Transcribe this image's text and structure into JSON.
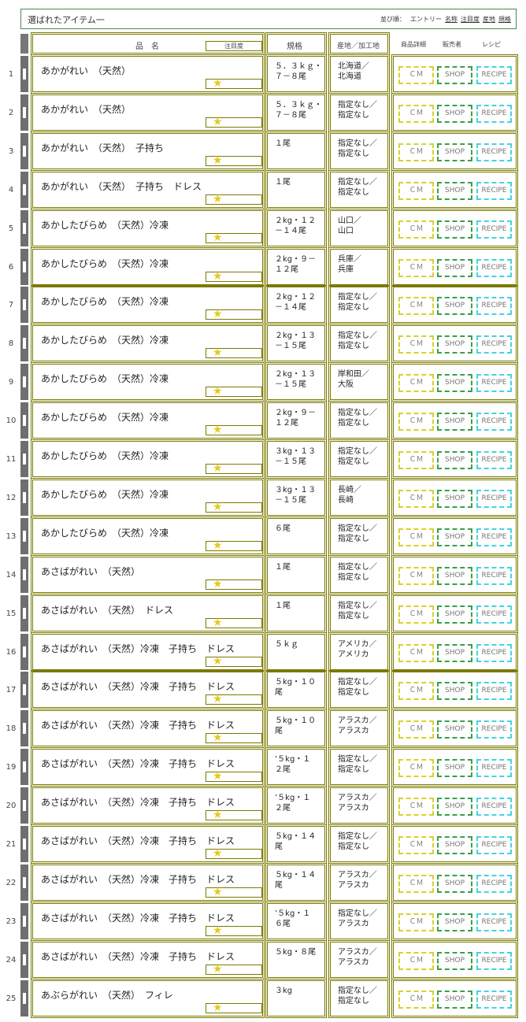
{
  "header": {
    "title": "選ばれたアイテム一",
    "sort_label": "並び順：",
    "sort_options": [
      "エントリー",
      "名称",
      "注目度",
      "産地",
      "規格"
    ]
  },
  "columns": {
    "name": "品　名",
    "attention": "注目度",
    "spec": "規格",
    "origin": "産地／加工地",
    "detail": "商品詳細",
    "seller": "販売者",
    "recipe": "レシピ"
  },
  "buttons": {
    "cm": "ＣＭ",
    "shop": "SHOP",
    "recipe": "RECIPE"
  },
  "star": "★",
  "rows": [
    {
      "no": "1",
      "name": "あかがれい　（天然）",
      "spec": "５．３ｋｇ・\n７－８尾",
      "origin": "北海道／\n北海道"
    },
    {
      "no": "2",
      "name": "あかがれい　（天然）",
      "spec": "５．３ｋｇ・\n７－８尾",
      "origin": "指定なし／\n指定なし"
    },
    {
      "no": "3",
      "name": "あかがれい　（天然）　子持ち",
      "spec": "１尾",
      "origin": "指定なし／\n指定なし"
    },
    {
      "no": "4",
      "name": "あかがれい　（天然）　子持ち　ドレス",
      "spec": "１尾",
      "origin": "指定なし／\n指定なし"
    },
    {
      "no": "5",
      "name": "あかしたびらめ　（天然）冷凍",
      "spec": "２kg・１２\n－１４尾",
      "origin": "山口／\n山口"
    },
    {
      "no": "6",
      "name": "あかしたびらめ　（天然）冷凍",
      "spec": "２kg・９－\n１２尾",
      "origin": "兵庫／\n兵庫"
    },
    {
      "no": "7",
      "name": "あかしたびらめ　（天然）冷凍",
      "spec": "２kg・１２\n－１４尾",
      "origin": "指定なし／\n指定なし"
    },
    {
      "no": "8",
      "name": "あかしたびらめ　（天然）冷凍",
      "spec": "２kg・１３\n－１５尾",
      "origin": "指定なし／\n指定なし"
    },
    {
      "no": "9",
      "name": "あかしたびらめ　（天然）冷凍",
      "spec": "２kg・１３\n－１５尾",
      "origin": "岸和田／\n大阪"
    },
    {
      "no": "10",
      "name": "あかしたびらめ　（天然）冷凍",
      "spec": "２kg・９－\n１２尾",
      "origin": "指定なし／\n指定なし"
    },
    {
      "no": "11",
      "name": "あかしたびらめ　（天然）冷凍",
      "spec": "３kg・１３\n－１５尾",
      "origin": "指定なし／\n指定なし"
    },
    {
      "no": "12",
      "name": "あかしたびらめ　（天然）冷凍",
      "spec": "３kg・１３\n－１５尾",
      "origin": "長崎／\n長崎"
    },
    {
      "no": "13",
      "name": "あかしたびらめ　（天然）冷凍",
      "spec": "６尾",
      "origin": "指定なし／\n指定なし"
    },
    {
      "no": "14",
      "name": "あさばがれい　（天然）",
      "spec": "１尾",
      "origin": "指定なし／\n指定なし"
    },
    {
      "no": "15",
      "name": "あさばがれい　（天然）　ドレス",
      "spec": "１尾",
      "origin": "指定なし／\n指定なし"
    },
    {
      "no": "16",
      "name": "あさばがれい　（天然）冷凍　子持ち　ドレス",
      "spec": "５ｋｇ",
      "origin": "アメリカ／\nアメリカ"
    },
    {
      "no": "17",
      "name": "あさばがれい　（天然）冷凍　子持ち　ドレス",
      "spec": "５kg・１０\n尾",
      "origin": "指定なし／\n指定なし"
    },
    {
      "no": "18",
      "name": "あさばがれい　（天然）冷凍　子持ち　ドレス",
      "spec": "５kg・１０\n尾",
      "origin": "アラスカ／\nアラスカ"
    },
    {
      "no": "19",
      "name": "あさばがれい　（天然）冷凍　子持ち　ドレス",
      "spec": "’５kg・１\n２尾",
      "origin": "指定なし／\n指定なし"
    },
    {
      "no": "20",
      "name": "あさばがれい　（天然）冷凍　子持ち　ドレス",
      "spec": "’５kg・１\n２尾",
      "origin": "アラスカ／\nアラスカ"
    },
    {
      "no": "21",
      "name": "あさばがれい　（天然）冷凍　子持ち　ドレス",
      "spec": "５kg・１４\n尾",
      "origin": "指定なし／\n指定なし"
    },
    {
      "no": "22",
      "name": "あさばがれい　（天然）冷凍　子持ち　ドレス",
      "spec": "５kg・１４\n尾",
      "origin": "アラスカ／\nアラスカ"
    },
    {
      "no": "23",
      "name": "あさばがれい　（天然）冷凍　子持ち　ドレス",
      "spec": "’５kg・１\n６尾",
      "origin": "指定なし／\nアラスカ"
    },
    {
      "no": "24",
      "name": "あさばがれい　（天然）冷凍　子持ち　ドレス",
      "spec": "５kg・８尾",
      "origin": "アラスカ／\nアラスカ"
    },
    {
      "no": "25",
      "name": "あぶらがれい　（天然）　フィレ",
      "spec": "３kg",
      "origin": "指定なし／\n指定なし"
    }
  ]
}
